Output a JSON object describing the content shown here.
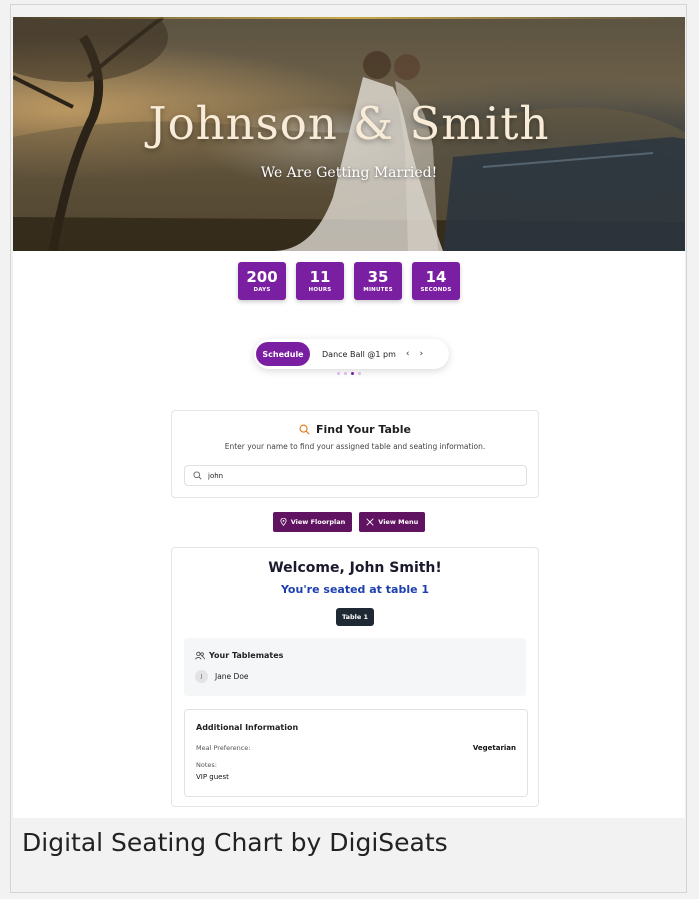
{
  "hero": {
    "title": "Johnson & Smith",
    "subtitle": "We Are Getting Married!"
  },
  "countdown": [
    {
      "value": "200",
      "label": "DAYS"
    },
    {
      "value": "11",
      "label": "HOURS"
    },
    {
      "value": "35",
      "label": "MINUTES"
    },
    {
      "value": "14",
      "label": "SECONDS"
    }
  ],
  "schedule": {
    "button_label": "Schedule",
    "event_text": "Dance Ball @1 pm",
    "prev_icon": "chevron-left-icon",
    "next_icon": "chevron-right-icon",
    "dot_count": 4,
    "active_dot": 3
  },
  "find_table": {
    "icon": "search-icon",
    "title": "Find Your Table",
    "description": "Enter your name to find your assigned table and seating information.",
    "search_value": "john"
  },
  "actions": {
    "floorplan_label": "View Floorplan",
    "floorplan_icon": "map-pin-icon",
    "menu_label": "View Menu",
    "menu_icon": "utensils-icon"
  },
  "result": {
    "welcome": "Welcome, John Smith!",
    "seated": "You're seated at table 1",
    "table_badge": "Table 1",
    "tablemates_title": "Your Tablemates",
    "tablemates": [
      {
        "initial": "J",
        "name": "Jane Doe"
      }
    ],
    "info_title": "Additional Information",
    "meal_label": "Meal Preference:",
    "meal_value": "Vegetarian",
    "notes_label": "Notes:",
    "notes_value": "VIP guest"
  },
  "caption": "Digital Seating Chart  by DigiSeats",
  "colors": {
    "accent": "#7b1fa2",
    "button_dark": "#5f1360",
    "seat_blue": "#1e40af",
    "search_icon": "#e67e22"
  }
}
